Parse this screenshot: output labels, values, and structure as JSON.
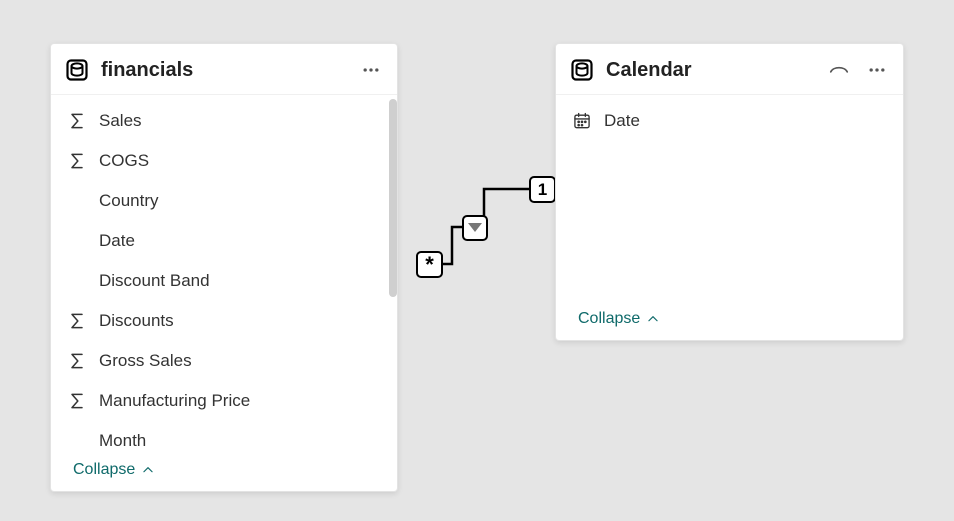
{
  "tables": {
    "financials": {
      "title": "financials",
      "collapse_label": "Collapse",
      "fields": [
        {
          "name": "Sales",
          "icon": "sigma"
        },
        {
          "name": "COGS",
          "icon": "sigma"
        },
        {
          "name": "Country",
          "icon": "none"
        },
        {
          "name": "Date",
          "icon": "none"
        },
        {
          "name": "Discount Band",
          "icon": "none"
        },
        {
          "name": "Discounts",
          "icon": "sigma"
        },
        {
          "name": "Gross Sales",
          "icon": "sigma"
        },
        {
          "name": "Manufacturing Price",
          "icon": "sigma"
        },
        {
          "name": "Month",
          "icon": "none"
        }
      ]
    },
    "calendar": {
      "title": "Calendar",
      "collapse_label": "Collapse",
      "fields": [
        {
          "name": "Date",
          "icon": "calendar"
        }
      ]
    }
  },
  "relationship": {
    "left_cardinality": "*",
    "right_cardinality": "1",
    "direction": "both"
  }
}
